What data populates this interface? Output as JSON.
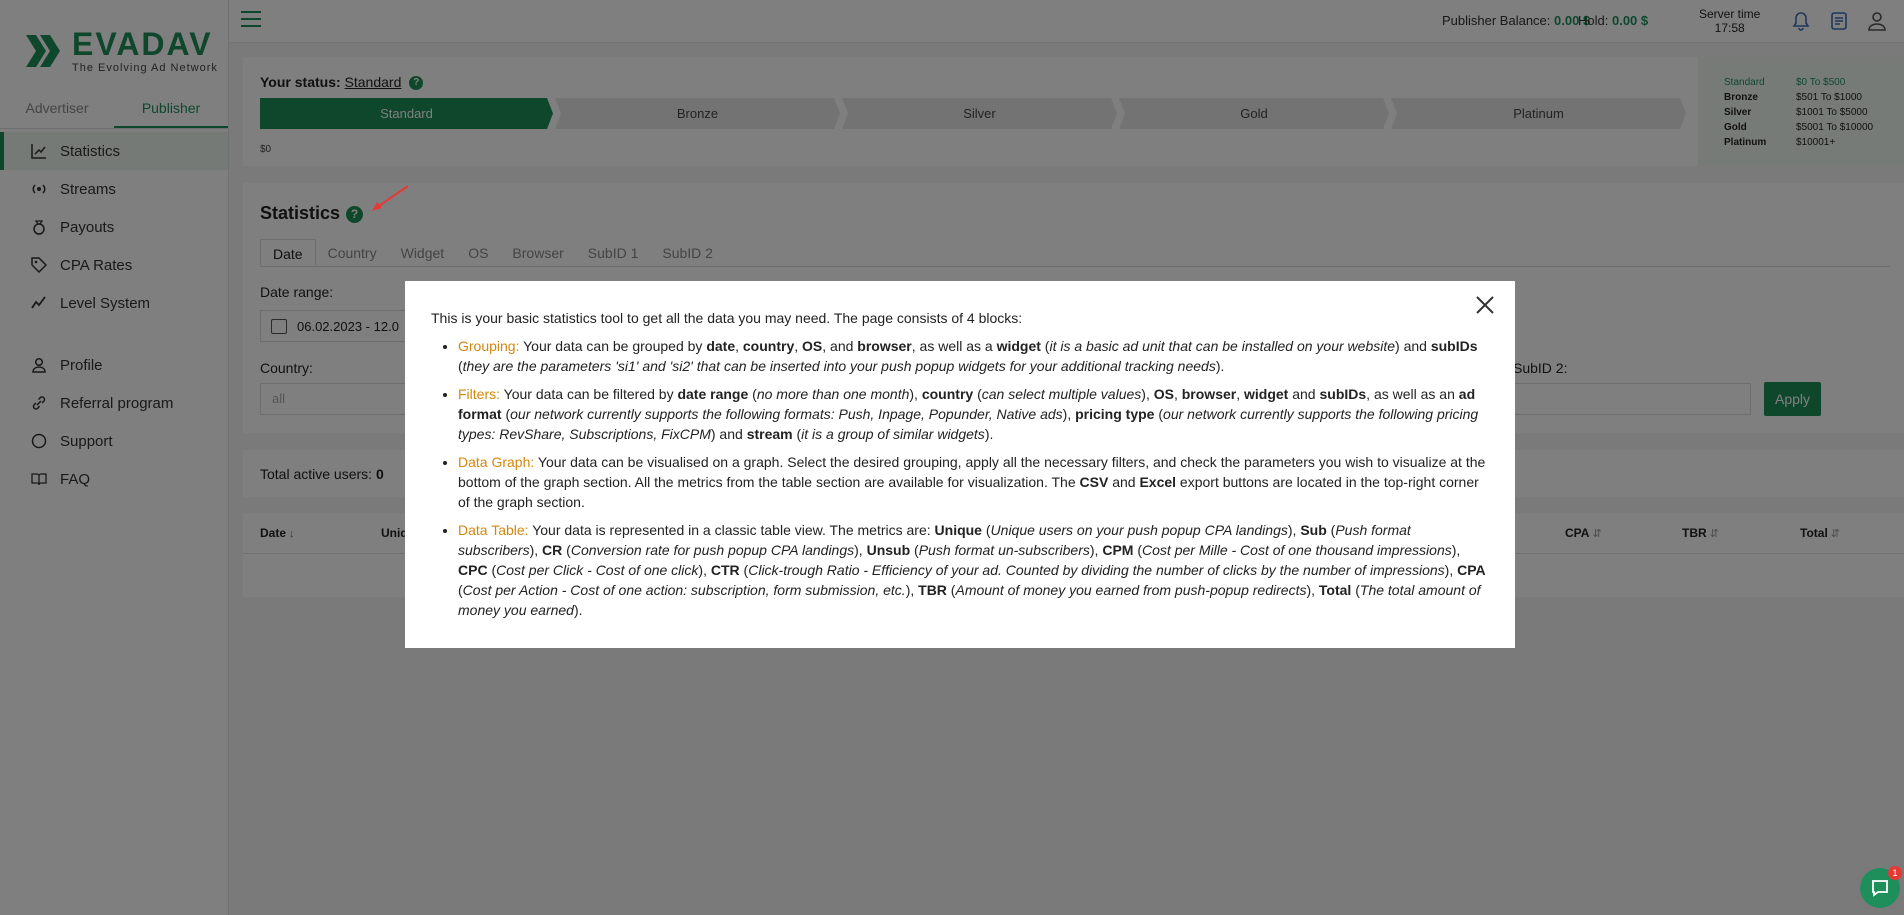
{
  "brand": {
    "name": "EVADAV",
    "tagline": "The Evolving Ad Network",
    "color": "#1e8f5a"
  },
  "sidebar": {
    "role_tabs": [
      {
        "label": "Advertiser"
      },
      {
        "label": "Publisher"
      }
    ],
    "items": [
      {
        "label": "Statistics",
        "icon": "chart-icon"
      },
      {
        "label": "Streams",
        "icon": "broadcast-icon"
      },
      {
        "label": "Payouts",
        "icon": "money-bag-icon"
      },
      {
        "label": "CPA Rates",
        "icon": "tag-icon"
      },
      {
        "label": "Level System",
        "icon": "trend-icon"
      },
      {
        "label": "Profile",
        "icon": "user-icon"
      },
      {
        "label": "Referral program",
        "icon": "link-icon"
      },
      {
        "label": "Support",
        "icon": "chat-bubble-icon"
      },
      {
        "label": "FAQ",
        "icon": "book-icon"
      }
    ]
  },
  "topbar": {
    "balance_label": "Publisher Balance:",
    "balance_value": "0.00 $",
    "hold_label": "Hold:",
    "hold_value": "0.00 $",
    "server_time_label": "Server time",
    "server_time_value": "17:58"
  },
  "status": {
    "title": "Your status:",
    "value": "Standard",
    "levels": [
      "Standard",
      "Bronze",
      "Silver",
      "Gold",
      "Platinum"
    ],
    "min_value": "$0",
    "tiers": [
      {
        "name": "Standard",
        "range": "$0 To $500"
      },
      {
        "name": "Bronze",
        "range": "$501 To $1000"
      },
      {
        "name": "Silver",
        "range": "$1001 To $5000"
      },
      {
        "name": "Gold",
        "range": "$5001 To $10000"
      },
      {
        "name": "Platinum",
        "range": "$10001+"
      }
    ]
  },
  "statistics": {
    "title": "Statistics",
    "tabs": [
      "Date",
      "Country",
      "Widget",
      "OS",
      "Browser",
      "SubID 1",
      "SubID 2"
    ],
    "date_range_label": "Date range:",
    "date_range_value": "06.02.2023 - 12.0",
    "country_label": "Country:",
    "country_placeholder": "all",
    "subid2_label": "SubID 2:",
    "apply_label": "Apply"
  },
  "users": {
    "label": "Total active users:",
    "value": "0"
  },
  "table": {
    "headers": [
      {
        "label": "Date",
        "sort": "↓"
      },
      {
        "label": "Uniq",
        "sort": ""
      },
      {
        "label": "CPA",
        "sort": "⇵"
      },
      {
        "label": "TBR",
        "sort": "⇵"
      },
      {
        "label": "Total",
        "sort": "⇵"
      }
    ]
  },
  "modal": {
    "intro": "This is your basic statistics tool to get all the data you may need. The page consists of 4 blocks:",
    "b1": {
      "h": "Grouping:",
      "t1": " Your data can be grouped by ",
      "k1": "date",
      "t2": ", ",
      "k2": "country",
      "t3": ", ",
      "k3": "OS",
      "t4": ", and ",
      "k4": "browser",
      "t5": ", as well as a ",
      "k5": "widget",
      "t6": " (",
      "i1": "it is a basic ad unit that can be installed on your website",
      "t7": ") and ",
      "k6": "subIDs",
      "t8": " (",
      "i2": "they are the parameters 'si1' and 'si2' that can be inserted into your push popup widgets for your additional tracking needs",
      "t9": ")."
    },
    "b2": {
      "h": "Filters:",
      "t1": " Your data can be filtered by ",
      "k1": "date range",
      "t2": " (",
      "i1": "no more than one month",
      "t3": "), ",
      "k2": "country",
      "t4": " (",
      "i2": "can select multiple values",
      "t5": "), ",
      "k3": "OS",
      "t6": ", ",
      "k4": "browser",
      "t7": ", ",
      "k5": "widget",
      "t8": " and ",
      "k6": "subIDs",
      "t9": ", as well as an ",
      "k7": "ad format",
      "t10": " (",
      "i3": "our network currently supports the following formats: Push, Inpage, Popunder, Native ads",
      "t11": "), ",
      "k8": "pricing type",
      "t12": " (",
      "i4": "our network currently supports the following pricing types: RevShare, Subscriptions, FixCPM",
      "t13": ") and ",
      "k9": "stream",
      "t14": " (",
      "i5": "it is a group of similar widgets",
      "t15": ")."
    },
    "b3": {
      "h": "Data Graph:",
      "t1": " Your data can be visualised on a graph. Select the desired grouping, apply all the necessary filters, and check the parameters you wish to visualize at the bottom of the graph section. All the metrics from the table section are available for visualization. The ",
      "k1": "CSV",
      "t2": " and ",
      "k2": "Excel",
      "t3": " export buttons are located in the top-right corner of the graph section."
    },
    "b4": {
      "h": "Data Table:",
      "t1": " Your data is represented in a classic table view. The metrics are: ",
      "k1": "Unique",
      "t2": " (",
      "i1": "Unique users on your push popup CPA landings",
      "t3": "), ",
      "k2": "Sub",
      "t4": " (",
      "i2": "Push format subscribers",
      "t5": "), ",
      "k3": "CR",
      "t6": " (",
      "i3": "Conversion rate for push popup CPA landings",
      "t7": "), ",
      "k4": "Unsub",
      "t8": " (",
      "i4": "Push format un-subscribers",
      "t9": "), ",
      "k5": "CPM",
      "t10": " (",
      "i5": "Cost per Mille - Cost of one thousand impressions",
      "t11": "), ",
      "k6": "CPC",
      "t12": " (",
      "i6": "Cost per Click - Cost of one click",
      "t13": "), ",
      "k7": "CTR",
      "t14": " (",
      "i7": "Click-trough Ratio - Efficiency of your ad. Counted by dividing the number of clicks by the number of impressions",
      "t15": "), ",
      "k8": "CPA",
      "t16": " (",
      "i8": "Cost per Action - Cost of one action: subscription, form submission, etc.",
      "t17": "), ",
      "k9": "TBR",
      "t18": " (",
      "i9": "Amount of money you earned from push-popup redirects",
      "t19": "), ",
      "k10": "Total",
      "t20": " (",
      "i10": "The total amount of money you earned",
      "t21": ")."
    }
  },
  "chat": {
    "badge": "1"
  }
}
